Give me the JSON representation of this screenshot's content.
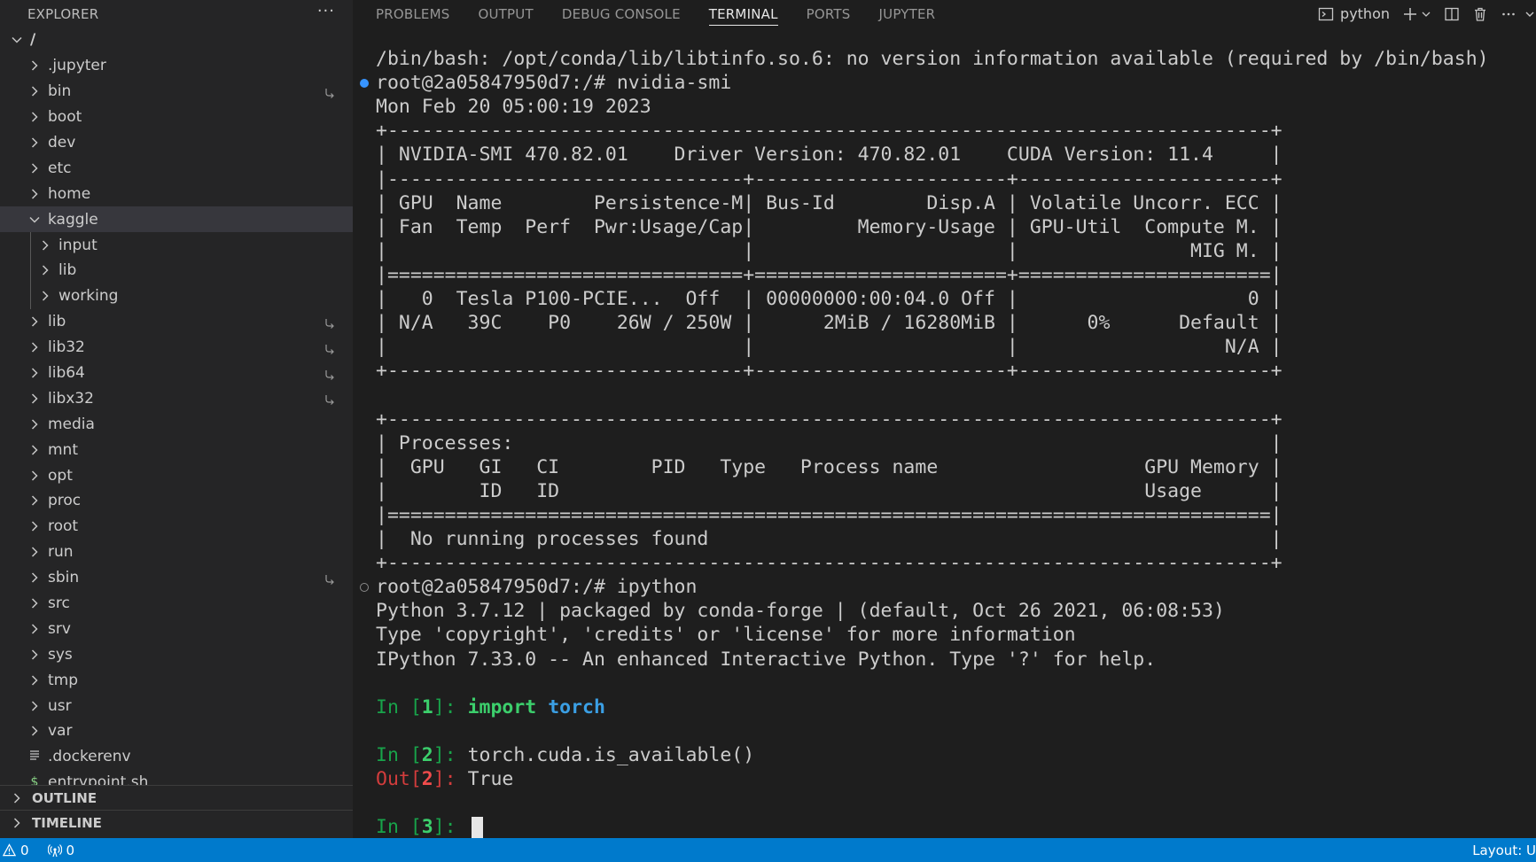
{
  "sidebar": {
    "title": "EXPLORER",
    "more": "···",
    "root": "/",
    "items": [
      {
        "label": ".jupyter",
        "link": false
      },
      {
        "label": "bin",
        "link": true
      },
      {
        "label": "boot",
        "link": false
      },
      {
        "label": "dev",
        "link": false
      },
      {
        "label": "etc",
        "link": false
      },
      {
        "label": "home",
        "link": false
      },
      {
        "label": "kaggle",
        "expanded": true,
        "selected": true
      },
      {
        "label": "input",
        "child": true
      },
      {
        "label": "lib",
        "child": true
      },
      {
        "label": "working",
        "child": true
      },
      {
        "label": "lib",
        "link": true
      },
      {
        "label": "lib32",
        "link": true
      },
      {
        "label": "lib64",
        "link": true
      },
      {
        "label": "libx32",
        "link": true
      },
      {
        "label": "media",
        "link": false
      },
      {
        "label": "mnt",
        "link": false
      },
      {
        "label": "opt",
        "link": false
      },
      {
        "label": "proc",
        "link": false
      },
      {
        "label": "root",
        "link": false
      },
      {
        "label": "run",
        "link": false
      },
      {
        "label": "sbin",
        "link": true
      },
      {
        "label": "src",
        "link": false
      },
      {
        "label": "srv",
        "link": false
      },
      {
        "label": "sys",
        "link": false
      },
      {
        "label": "tmp",
        "link": false
      },
      {
        "label": "usr",
        "link": false
      },
      {
        "label": "var",
        "link": false
      },
      {
        "label": ".dockerenv",
        "file": true
      },
      {
        "label": "entrypoint.sh",
        "file": true,
        "icon": "$"
      }
    ],
    "outline": "OUTLINE",
    "timeline": "TIMELINE"
  },
  "panel": {
    "tabs": [
      "PROBLEMS",
      "OUTPUT",
      "DEBUG CONSOLE",
      "TERMINAL",
      "PORTS",
      "JUPYTER"
    ],
    "active_tab": "TERMINAL",
    "terminal_name": "python"
  },
  "terminal": {
    "lines": [
      {
        "text": "/bin/bash: /opt/conda/lib/libtinfo.so.6: no version information available (required by /bin/bash)"
      },
      {
        "text": "root@2a05847950d7:/# nvidia-smi",
        "deco": "ok"
      },
      {
        "text": "Mon Feb 20 05:00:19 2023"
      },
      {
        "text": "+-----------------------------------------------------------------------------+"
      },
      {
        "text": "| NVIDIA-SMI 470.82.01    Driver Version: 470.82.01    CUDA Version: 11.4     |"
      },
      {
        "text": "|-------------------------------+----------------------+----------------------+"
      },
      {
        "text": "| GPU  Name        Persistence-M| Bus-Id        Disp.A | Volatile Uncorr. ECC |"
      },
      {
        "text": "| Fan  Temp  Perf  Pwr:Usage/Cap|         Memory-Usage | GPU-Util  Compute M. |"
      },
      {
        "text": "|                               |                      |               MIG M. |"
      },
      {
        "text": "|===============================+======================+======================|"
      },
      {
        "text": "|   0  Tesla P100-PCIE...  Off  | 00000000:00:04.0 Off |                    0 |"
      },
      {
        "text": "| N/A   39C    P0    26W / 250W |      2MiB / 16280MiB |      0%      Default |"
      },
      {
        "text": "|                               |                      |                  N/A |"
      },
      {
        "text": "+-------------------------------+----------------------+----------------------+"
      },
      {
        "text": ""
      },
      {
        "text": "+-----------------------------------------------------------------------------+"
      },
      {
        "text": "| Processes:                                                                  |"
      },
      {
        "text": "|  GPU   GI   CI        PID   Type   Process name                  GPU Memory |"
      },
      {
        "text": "|        ID   ID                                                   Usage      |"
      },
      {
        "text": "|=============================================================================|"
      },
      {
        "text": "|  No running processes found                                                 |"
      },
      {
        "text": "+-----------------------------------------------------------------------------+"
      },
      {
        "text": "root@2a05847950d7:/# ipython",
        "deco": "pending"
      },
      {
        "text": "Python 3.7.12 | packaged by conda-forge | (default, Oct 26 2021, 06:08:53)"
      },
      {
        "text": "Type 'copyright', 'credits' or 'license' for more information"
      },
      {
        "text": "IPython 7.33.0 -- An enhanced Interactive Python. Type '?' for help."
      },
      {
        "text": ""
      }
    ],
    "cell1": {
      "prompt_a": "In [",
      "num": "1",
      "prompt_b": "]: ",
      "kw": "import",
      "mod": "torch"
    },
    "cell2": {
      "prompt_a": "In [",
      "num": "2",
      "prompt_b": "]: ",
      "code": "torch.cuda.is_available()"
    },
    "out2": {
      "prompt_a": "Out[",
      "num": "2",
      "prompt_b": "]: ",
      "value": "True"
    },
    "cell3": {
      "prompt_a": "In [",
      "num": "3",
      "prompt_b": "]: "
    }
  },
  "status": {
    "warnings": "0",
    "ports": "0",
    "layout": "Layout: U"
  }
}
